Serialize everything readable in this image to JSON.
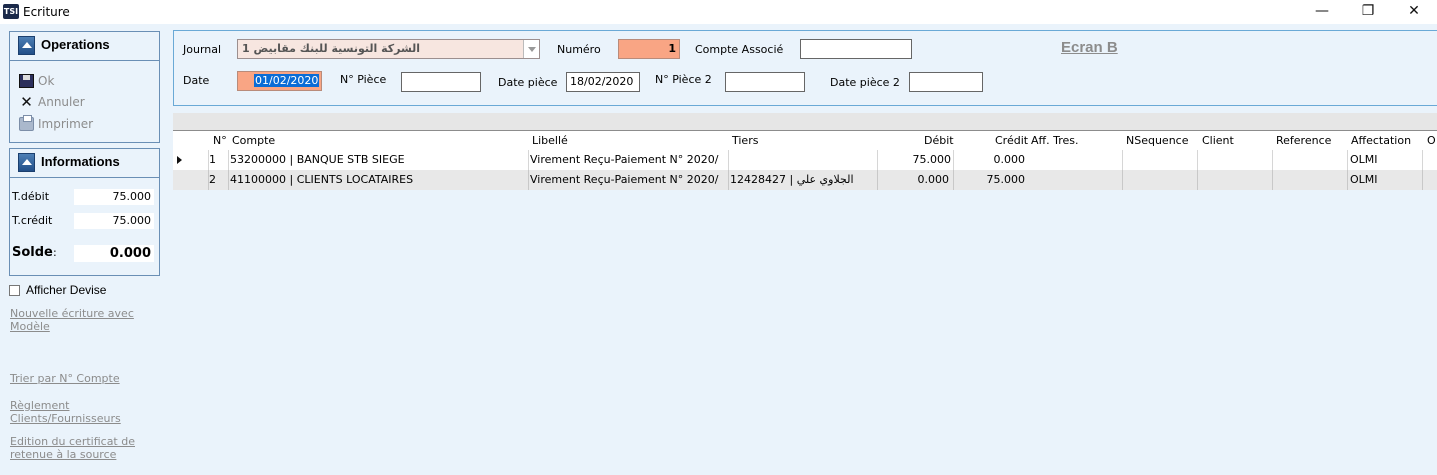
{
  "window": {
    "app_icon_text": "TSI",
    "title": "Ecriture",
    "minimize_glyph": "—",
    "maximize_glyph": "❐",
    "close_glyph": "✕"
  },
  "operations": {
    "title": "Operations",
    "items": [
      {
        "label": "Ok",
        "icon": "save-icon"
      },
      {
        "label": "Annuler",
        "icon": "x-icon"
      },
      {
        "label": "Imprimer",
        "icon": "printer-icon"
      }
    ]
  },
  "informations": {
    "title": "Informations",
    "t_debit_label": "T.débit",
    "t_debit_value": "75.000",
    "t_credit_label": "T.crédit",
    "t_credit_value": "75.000",
    "solde_label": "Solde",
    "solde_colon": ":",
    "solde_value": "0.000"
  },
  "afficher_devise": "Afficher Devise",
  "links": {
    "nouvelle": "Nouvelle écriture avec Modèle",
    "trier": "Trier par N° Compte",
    "reglement": "Règlement Clients/Fournisseurs",
    "edition": "Edition du certificat de retenue à la source"
  },
  "form": {
    "journal_label": "Journal",
    "journal_value": "الشركة  التونسية  للبنك مقابيض 1",
    "numero_label": "Numéro",
    "numero_value": "1",
    "compte_associe_label": "Compte Associé",
    "compte_associe_value": "",
    "date_label": "Date",
    "date_value": "01/02/2020",
    "n_piece_label": "N° Pièce",
    "n_piece_value": "",
    "date_piece_label": "Date pièce",
    "date_piece_value": "18/02/2020",
    "n_piece2_label": "N° Pièce 2",
    "n_piece2_value": "",
    "date_piece2_label": "Date pièce 2",
    "date_piece2_value": "",
    "ecran": "Ecran B"
  },
  "grid": {
    "headers": {
      "num": "N°",
      "compte": "Compte",
      "libelle": "Libellé",
      "tiers": "Tiers",
      "debit": "Débit",
      "credit": "Crédit",
      "aff_tres": "Aff. Tres.",
      "nsequence": "NSequence",
      "client": "Client",
      "reference": "Reference",
      "affectation": "Affectation",
      "extra": "O"
    },
    "rows": [
      {
        "num": "1",
        "compte": "53200000 | BANQUE STB SIEGE",
        "libelle": "Virement Reçu-Paiement N° 2020/",
        "tiers": "",
        "debit": "75.000",
        "credit": "0.000",
        "affectation": "OLMI"
      },
      {
        "num": "2",
        "compte": "41100000 | CLIENTS LOCATAIRES",
        "libelle": "Virement Reçu-Paiement N° 2020/",
        "tiers": "12428427 | الجلاوي علي",
        "debit": "0.000",
        "credit": "75.000",
        "affectation": "OLMI"
      }
    ]
  }
}
